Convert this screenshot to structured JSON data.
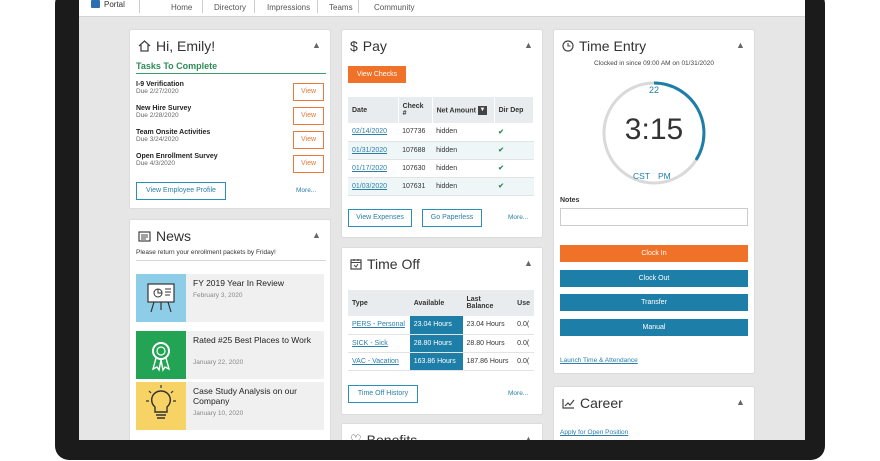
{
  "nav": {
    "portal": "Portal",
    "items": [
      "Home",
      "Directory",
      "Impressions",
      "Teams",
      "Community"
    ]
  },
  "hi": {
    "title": "Hi, Emily!",
    "tasks_title": "Tasks To Complete",
    "tasks": [
      {
        "name": "I-9 Verification",
        "due": "Due 2/27/2020",
        "btn": "View"
      },
      {
        "name": "New Hire Survey",
        "due": "Due 2/28/2020",
        "btn": "View"
      },
      {
        "name": "Team Onsite Activities",
        "due": "Due 3/24/2020",
        "btn": "View"
      },
      {
        "name": "Open Enrollment Survey",
        "due": "Due 4/3/2020",
        "btn": "View"
      }
    ],
    "profile_btn": "View Employee Profile",
    "more": "More..."
  },
  "news": {
    "title": "News",
    "message": "Please return your enrollment packets by Friday!",
    "items": [
      {
        "title": "FY 2019 Year In Review",
        "date": "February 3, 2020"
      },
      {
        "title": "Rated #25 Best Places to Work",
        "date": "January 22, 2020"
      },
      {
        "title": "Case Study Analysis on our Company",
        "date": "January 10, 2020"
      }
    ]
  },
  "pay": {
    "title": "Pay",
    "view_checks": "View Checks",
    "headers": [
      "Date",
      "Check #",
      "Net Amount",
      "Dir Dep"
    ],
    "rows": [
      {
        "date": "02/14/2020",
        "check": "107736",
        "amount": "hidden",
        "dep": "✔"
      },
      {
        "date": "01/31/2020",
        "check": "107688",
        "amount": "hidden",
        "dep": "✔"
      },
      {
        "date": "01/17/2020",
        "check": "107630",
        "amount": "hidden",
        "dep": "✔"
      },
      {
        "date": "01/03/2020",
        "check": "107631",
        "amount": "hidden",
        "dep": "✔"
      }
    ],
    "expenses_btn": "View Expenses",
    "paperless_btn": "Go Paperless",
    "more": "More..."
  },
  "timeoff": {
    "title": "Time Off",
    "headers": [
      "Type",
      "Available",
      "Last Balance",
      "Use"
    ],
    "rows": [
      {
        "type": "PERS - Personal",
        "available": "23.04 Hours",
        "last": "23.04 Hours",
        "use": "0.0("
      },
      {
        "type": "SICK - Sick",
        "available": "28.80 Hours",
        "last": "28.80 Hours",
        "use": "0.0("
      },
      {
        "type": "VAC - Vacation",
        "available": "163.86 Hours",
        "last": "187.86 Hours",
        "use": "0.0("
      }
    ],
    "history_btn": "Time Off History",
    "more": "More..."
  },
  "benefits": {
    "title": "Benefits"
  },
  "time_entry": {
    "title": "Time Entry",
    "clocked": "Clocked in since 09:00 AM on 01/31/2020",
    "seconds": "22",
    "time": "3:15",
    "tz": "CST",
    "ampm": "PM",
    "notes_label": "Notes",
    "clock_in": "Clock In",
    "clock_out": "Clock Out",
    "transfer": "Transfer",
    "manual": "Manual",
    "launch_link": "Launch Time & Attendance"
  },
  "career": {
    "title": "Career",
    "link": "Apply for Open Position"
  },
  "colors": {
    "accent": "#f07228",
    "primary": "#1d7ea8",
    "green": "#2e8b57"
  }
}
